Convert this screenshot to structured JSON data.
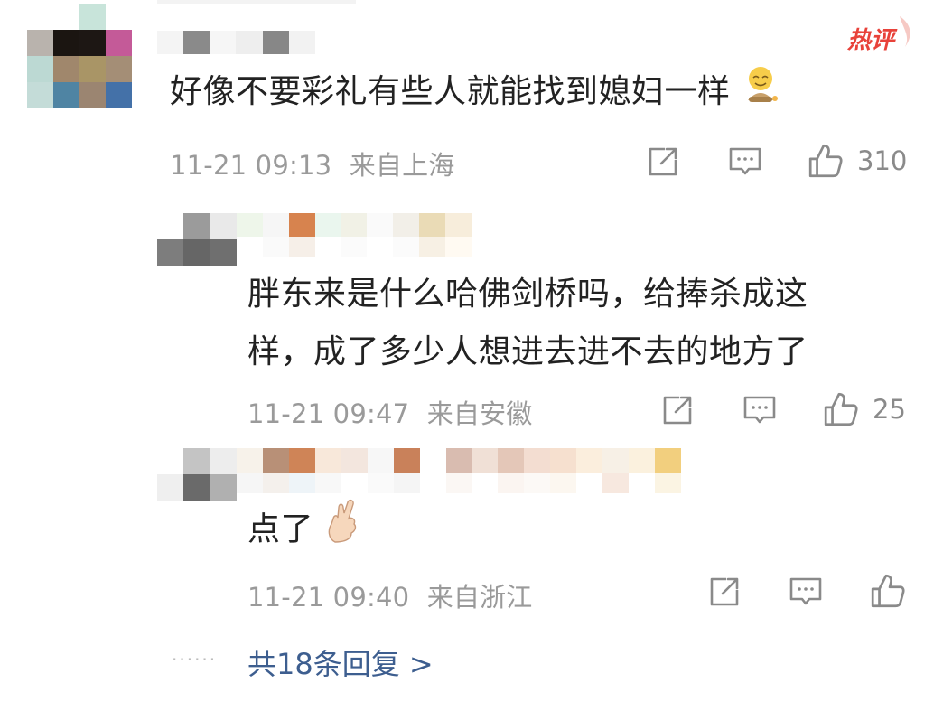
{
  "comments": [
    {
      "text": "好像不要彩礼有些人就能找到媳妇一样",
      "emoji": "smiling-face-emoji",
      "time": "11-21 09:13",
      "location": "来自上海",
      "likes": "310",
      "badge": "热评"
    },
    {
      "text_line1": "胖东来是什么哈佛剑桥吗，给捧杀成这",
      "text_line2": "样，成了多少人想进去进不去的地方了",
      "time": "11-21 09:47",
      "location": "来自安徽",
      "likes": "25"
    },
    {
      "text": "点了",
      "emoji": "crossed-fingers-emoji",
      "time": "11-21 09:40",
      "location": "来自浙江",
      "likes": ""
    }
  ],
  "footer": {
    "dots": "······",
    "replies_link": "共18条回复 >"
  },
  "colors": {
    "hot_badge": "#e8423a",
    "link": "#3d5e8f",
    "meta": "#9a9a9a",
    "icon": "#8a8a8a"
  }
}
